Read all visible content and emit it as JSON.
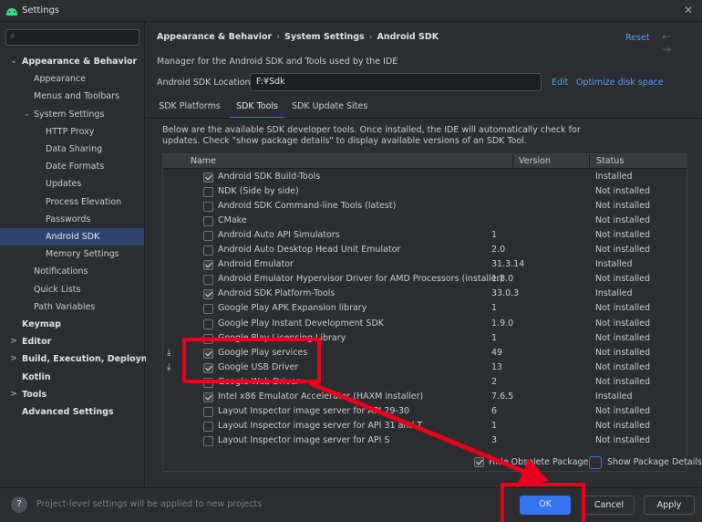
{
  "window": {
    "title": "Settings"
  },
  "search": {
    "placeholder": ""
  },
  "sidebar": {
    "items": [
      {
        "label": "Appearance & Behavior",
        "level": 0,
        "arrow": "⌄"
      },
      {
        "label": "Appearance",
        "level": 1
      },
      {
        "label": "Menus and Toolbars",
        "level": 1
      },
      {
        "label": "System Settings",
        "level": 1,
        "arrow": "⌄"
      },
      {
        "label": "HTTP Proxy",
        "level": 2
      },
      {
        "label": "Data Sharing",
        "level": 2
      },
      {
        "label": "Date Formats",
        "level": 2
      },
      {
        "label": "Updates",
        "level": 2
      },
      {
        "label": "Process Elevation",
        "level": 2
      },
      {
        "label": "Passwords",
        "level": 2
      },
      {
        "label": "Android SDK",
        "level": 2,
        "selected": true
      },
      {
        "label": "Memory Settings",
        "level": 2
      },
      {
        "label": "Notifications",
        "level": 1
      },
      {
        "label": "Quick Lists",
        "level": 1
      },
      {
        "label": "Path Variables",
        "level": 1
      },
      {
        "label": "Keymap",
        "level": 0
      },
      {
        "label": "Editor",
        "level": 0,
        "arrow": ">"
      },
      {
        "label": "Build, Execution, Deployment",
        "level": 0,
        "arrow": ">"
      },
      {
        "label": "Kotlin",
        "level": 0
      },
      {
        "label": "Tools",
        "level": 0,
        "arrow": ">"
      },
      {
        "label": "Advanced Settings",
        "level": 0
      }
    ]
  },
  "breadcrumb": [
    "Appearance & Behavior",
    "System Settings",
    "Android SDK"
  ],
  "breadcrumb_sep": "›",
  "header": {
    "reset": "Reset",
    "nav_arrows": "← →"
  },
  "description": "Manager for the Android SDK and Tools used by the IDE",
  "sdk_location": {
    "label": "Android SDK Location:",
    "value": "F:¥Sdk",
    "edit": "Edit",
    "optimize": "Optimize disk space"
  },
  "tabs": [
    {
      "label": "SDK Platforms",
      "active": false
    },
    {
      "label": "SDK Tools",
      "active": true
    },
    {
      "label": "SDK Update Sites",
      "active": false
    }
  ],
  "info_text": "Below are the available SDK developer tools. Once installed, the IDE will automatically check for updates. Check \"show package details\" to display available versions of an SDK Tool.",
  "table": {
    "columns": [
      "Name",
      "Version",
      "Status"
    ],
    "rows": [
      {
        "name": "Android SDK Build-Tools",
        "version": "",
        "status": "Installed",
        "checked": true,
        "download": false
      },
      {
        "name": "NDK (Side by side)",
        "version": "",
        "status": "Not installed",
        "checked": false,
        "download": false
      },
      {
        "name": "Android SDK Command-line Tools (latest)",
        "version": "",
        "status": "Not installed",
        "checked": false,
        "download": false
      },
      {
        "name": "CMake",
        "version": "",
        "status": "Not installed",
        "checked": false,
        "download": false
      },
      {
        "name": "Android Auto API Simulators",
        "version": "1",
        "status": "Not installed",
        "checked": false,
        "download": false
      },
      {
        "name": "Android Auto Desktop Head Unit Emulator",
        "version": "2.0",
        "status": "Not installed",
        "checked": false,
        "download": false
      },
      {
        "name": "Android Emulator",
        "version": "31.3.14",
        "status": "Installed",
        "checked": true,
        "download": false
      },
      {
        "name": "Android Emulator Hypervisor Driver for AMD Processors (installer)",
        "version": "1.8.0",
        "status": "Not installed",
        "checked": false,
        "download": false
      },
      {
        "name": "Android SDK Platform-Tools",
        "version": "33.0.3",
        "status": "Installed",
        "checked": true,
        "download": false
      },
      {
        "name": "Google Play APK Expansion library",
        "version": "1",
        "status": "Not installed",
        "checked": false,
        "download": false
      },
      {
        "name": "Google Play Instant Development SDK",
        "version": "1.9.0",
        "status": "Not installed",
        "checked": false,
        "download": false
      },
      {
        "name": "Google Play Licensing Library",
        "version": "1",
        "status": "Not installed",
        "checked": false,
        "download": false
      },
      {
        "name": "Google Play services",
        "version": "49",
        "status": "Not installed",
        "checked": true,
        "download": true
      },
      {
        "name": "Google USB Driver",
        "version": "13",
        "status": "Not installed",
        "checked": true,
        "download": true
      },
      {
        "name": "Google Web Driver",
        "version": "2",
        "status": "Not installed",
        "checked": false,
        "download": false
      },
      {
        "name": "Intel x86 Emulator Accelerator (HAXM installer)",
        "version": "7.6.5",
        "status": "Installed",
        "checked": true,
        "download": false
      },
      {
        "name": "Layout Inspector image server for API 29-30",
        "version": "6",
        "status": "Not installed",
        "checked": false,
        "download": false
      },
      {
        "name": "Layout Inspector image server for API 31 and T",
        "version": "1",
        "status": "Not installed",
        "checked": false,
        "download": false
      },
      {
        "name": "Layout Inspector image server for API S",
        "version": "3",
        "status": "Not installed",
        "checked": false,
        "download": false
      }
    ]
  },
  "options": {
    "hide_obsolete": "Hide Obsolete Packages",
    "hide_obsolete_checked": true,
    "show_details": "Show Package Details",
    "show_details_checked": false
  },
  "footer": {
    "help": "?",
    "text": "Project-level settings will be applied to new projects",
    "ok": "OK",
    "cancel": "Cancel",
    "apply": "Apply"
  },
  "icons": {
    "logo": "android-logo-icon",
    "close": "close-icon",
    "search": "search-icon",
    "download": "download-icon"
  },
  "colors": {
    "accent": "#3574f0",
    "selection": "#2e436e",
    "link": "#5c9cf5",
    "annotation": "#e8001c"
  }
}
